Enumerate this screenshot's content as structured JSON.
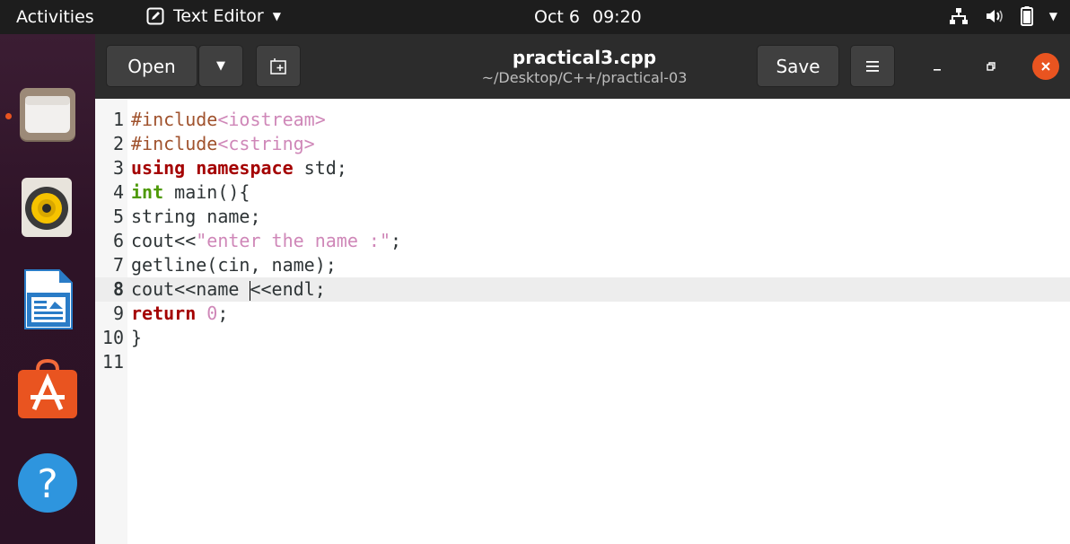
{
  "topbar": {
    "activities": "Activities",
    "app_name": "Text Editor",
    "date": "Oct 6",
    "time": "09:20",
    "icons": [
      "network-icon",
      "volume-icon",
      "battery-icon",
      "system-menu-caret-icon"
    ]
  },
  "dock": {
    "items": [
      "files-icon",
      "rhythmbox-icon",
      "libreoffice-writer-icon",
      "ubuntu-software-icon",
      "help-icon"
    ]
  },
  "header": {
    "open_label": "Open",
    "save_label": "Save",
    "title": "practical3.cpp",
    "subtitle": "~/Desktop/C++/practical-03"
  },
  "editor": {
    "current_line": 8,
    "lines": [
      {
        "n": "1",
        "tokens": [
          {
            "t": "#include",
            "c": "pp"
          },
          {
            "t": "<iostream>",
            "c": "inc"
          }
        ]
      },
      {
        "n": "2",
        "tokens": [
          {
            "t": "#include",
            "c": "pp"
          },
          {
            "t": "<cstring>",
            "c": "inc"
          }
        ]
      },
      {
        "n": "3",
        "tokens": [
          {
            "t": "using",
            "c": "kw"
          },
          {
            "t": " ",
            "c": ""
          },
          {
            "t": "namespace",
            "c": "kw"
          },
          {
            "t": " std;",
            "c": ""
          }
        ]
      },
      {
        "n": "4",
        "tokens": [
          {
            "t": "int",
            "c": "typ"
          },
          {
            "t": " main(){",
            "c": ""
          }
        ]
      },
      {
        "n": "5",
        "tokens": [
          {
            "t": "string name;",
            "c": ""
          }
        ]
      },
      {
        "n": "6",
        "tokens": [
          {
            "t": "cout<<",
            "c": ""
          },
          {
            "t": "\"enter the name :\"",
            "c": "str"
          },
          {
            "t": ";",
            "c": ""
          }
        ]
      },
      {
        "n": "7",
        "tokens": [
          {
            "t": "getline(cin, name);",
            "c": ""
          }
        ]
      },
      {
        "n": "8",
        "tokens": [
          {
            "t": "cout<<name ",
            "c": ""
          },
          {
            "t": "",
            "c": "caret"
          },
          {
            "t": "<<endl;",
            "c": ""
          }
        ]
      },
      {
        "n": "9",
        "tokens": [
          {
            "t": "return",
            "c": "kw"
          },
          {
            "t": " ",
            "c": ""
          },
          {
            "t": "0",
            "c": "num"
          },
          {
            "t": ";",
            "c": ""
          }
        ]
      },
      {
        "n": "10",
        "tokens": [
          {
            "t": "}",
            "c": ""
          }
        ]
      },
      {
        "n": "11",
        "tokens": []
      }
    ]
  },
  "colors": {
    "accent": "#e95420",
    "topbar": "#1d1d1d",
    "headerbar": "#2c2c2c"
  }
}
